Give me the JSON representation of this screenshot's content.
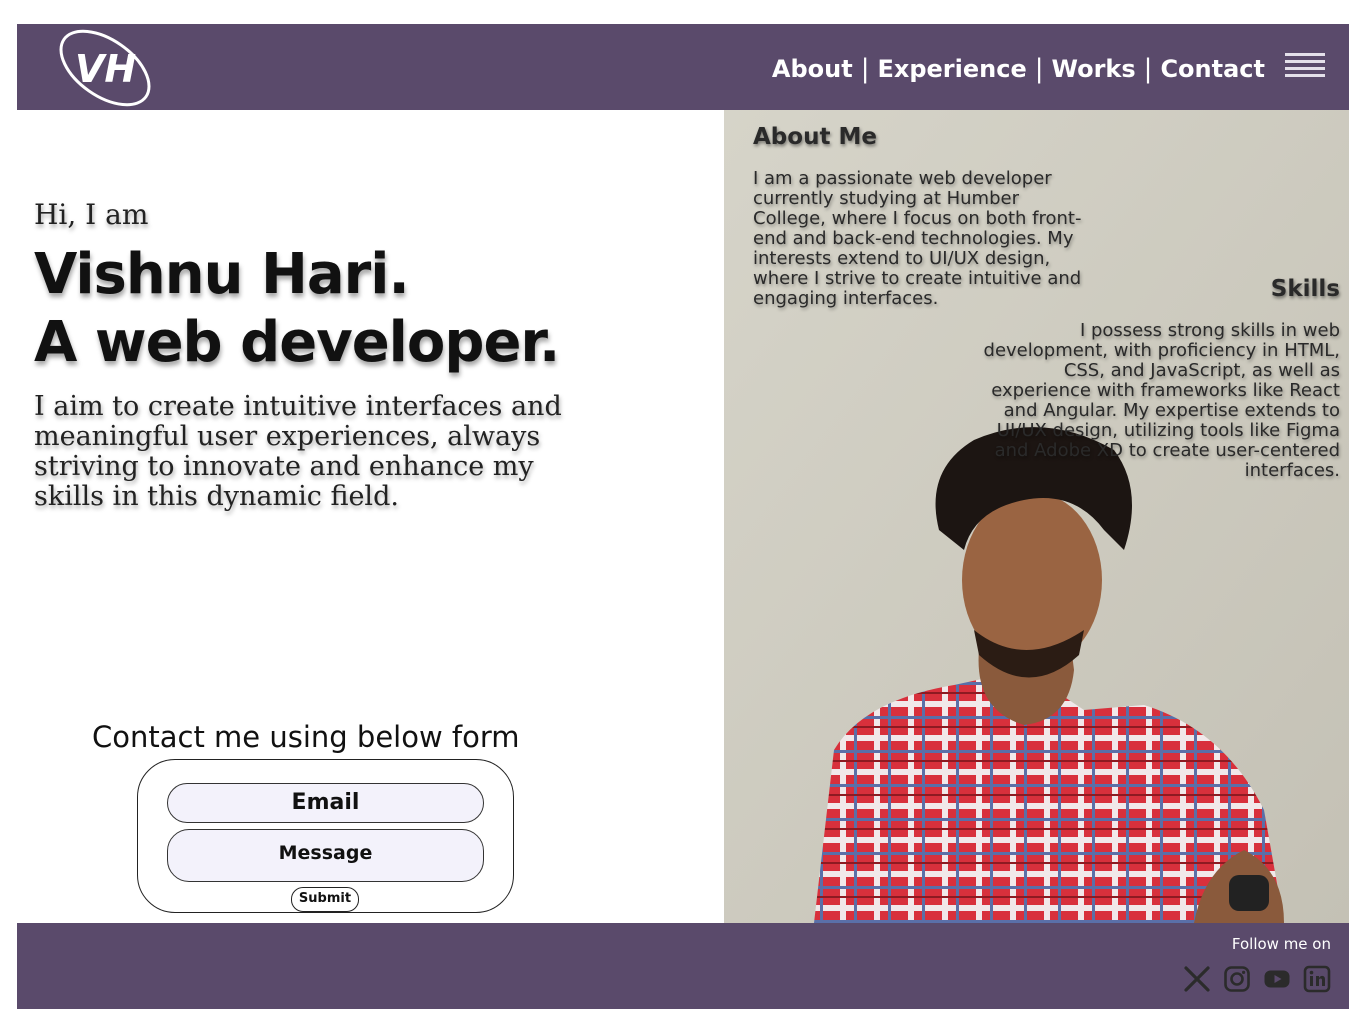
{
  "header": {
    "logo_text": "VH",
    "nav": [
      {
        "label": "About"
      },
      {
        "label": "Experience"
      },
      {
        "label": "Works"
      },
      {
        "label": "Contact"
      }
    ],
    "nav_separator": "|",
    "menu_icon": "hamburger-menu-icon"
  },
  "hero": {
    "greeting": "Hi, I am",
    "name": "Vishnu Hari.",
    "role": "A web developer.",
    "description": "I aim to create intuitive interfaces and meaningful user experiences, always striving to innovate and enhance my skills in this dynamic field."
  },
  "contact": {
    "heading": "Contact me using below form",
    "email_placeholder": "Email",
    "message_placeholder": "Message",
    "submit_label": "Submit"
  },
  "about": {
    "title": "About Me",
    "text": "I am a passionate web developer currently studying at Humber College, where I focus on both front-end and back-end technologies. My interests extend to UI/UX design, where I strive to create intuitive and engaging interfaces."
  },
  "skills": {
    "title": "Skills",
    "text": "I possess strong skills in web development, with proficiency in HTML, CSS, and JavaScript, as well as experience with frameworks like React and Angular. My expertise extends to UI/UX design, utilizing tools like Figma and Adobe XD to create user-centered interfaces."
  },
  "footer": {
    "follow_label": "Follow me on",
    "socials": [
      "x-icon",
      "instagram-icon",
      "youtube-icon",
      "linkedin-icon"
    ]
  },
  "colors": {
    "brand": "#5a4a6b",
    "nav_text": "#ffffff",
    "field_bg": "#f3f2fb"
  }
}
